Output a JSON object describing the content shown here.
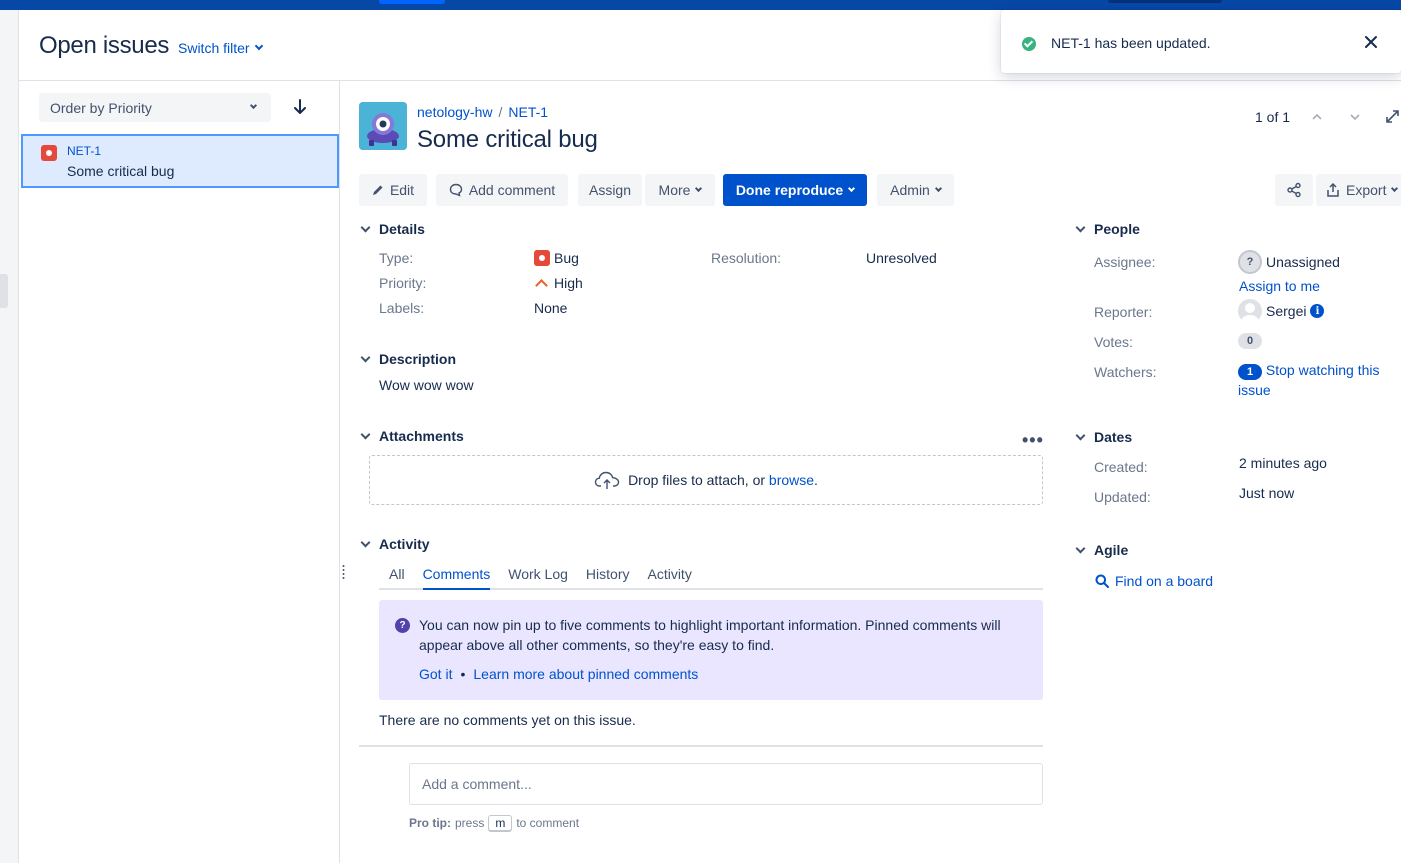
{
  "colors": {
    "brand": "#0747a6",
    "link": "#0052cc",
    "bug": "#e5493a",
    "priority_high": "#f15c25",
    "success": "#36b37e",
    "pin_banner": "#eae6ff"
  },
  "header": {
    "title": "Open issues",
    "switch_filter": "Switch filter"
  },
  "list": {
    "order_by": "Order by Priority",
    "sort_icon": "arrow-down-icon",
    "items": [
      {
        "key": "NET-1",
        "summary": "Some critical bug",
        "type_icon": "bug-icon"
      }
    ]
  },
  "issue": {
    "breadcrumb_project": "netology-hw",
    "breadcrumb_sep": "/",
    "breadcrumb_key": "NET-1",
    "title": "Some critical bug",
    "pager": "1 of 1"
  },
  "toolbar": {
    "edit": "Edit",
    "add_comment": "Add comment",
    "assign": "Assign",
    "more": "More",
    "workflow": "Done reproduce",
    "admin": "Admin",
    "export": "Export"
  },
  "details": {
    "heading": "Details",
    "type_label": "Type:",
    "type_value": "Bug",
    "priority_label": "Priority:",
    "priority_value": "High",
    "labels_label": "Labels:",
    "labels_value": "None",
    "resolution_label": "Resolution:",
    "resolution_value": "Unresolved"
  },
  "description": {
    "heading": "Description",
    "text": "Wow wow wow"
  },
  "attachments": {
    "heading": "Attachments",
    "drop_text": "Drop files to attach, or",
    "browse": "browse",
    "period": "."
  },
  "activity": {
    "heading": "Activity",
    "tabs": [
      "All",
      "Comments",
      "Work Log",
      "History",
      "Activity"
    ],
    "active_tab": "Comments",
    "pin_text": "You can now pin up to five comments to highlight important information. Pinned comments will appear above all other comments, so they're easy to find.",
    "got_it": "Got it",
    "bullet": "•",
    "learn_more": "Learn more about pinned comments",
    "no_comments": "There are no comments yet on this issue.",
    "comment_placeholder": "Add a comment...",
    "protip_label": "Pro tip:",
    "protip_press": "press",
    "protip_key": "m",
    "protip_suffix": "to comment"
  },
  "people": {
    "heading": "People",
    "assignee_label": "Assignee:",
    "assignee_value": "Unassigned",
    "assign_to_me": "Assign to me",
    "reporter_label": "Reporter:",
    "reporter_value": "Sergei",
    "votes_label": "Votes:",
    "votes_count": "0",
    "watchers_label": "Watchers:",
    "watchers_count": "1",
    "stop_watching": "Stop watching this issue"
  },
  "dates": {
    "heading": "Dates",
    "created_label": "Created:",
    "created_value": "2 minutes ago",
    "updated_label": "Updated:",
    "updated_value": "Just now"
  },
  "agile": {
    "heading": "Agile",
    "find_on_board": "Find on a board"
  },
  "toast": {
    "message": "NET-1 has been updated."
  }
}
